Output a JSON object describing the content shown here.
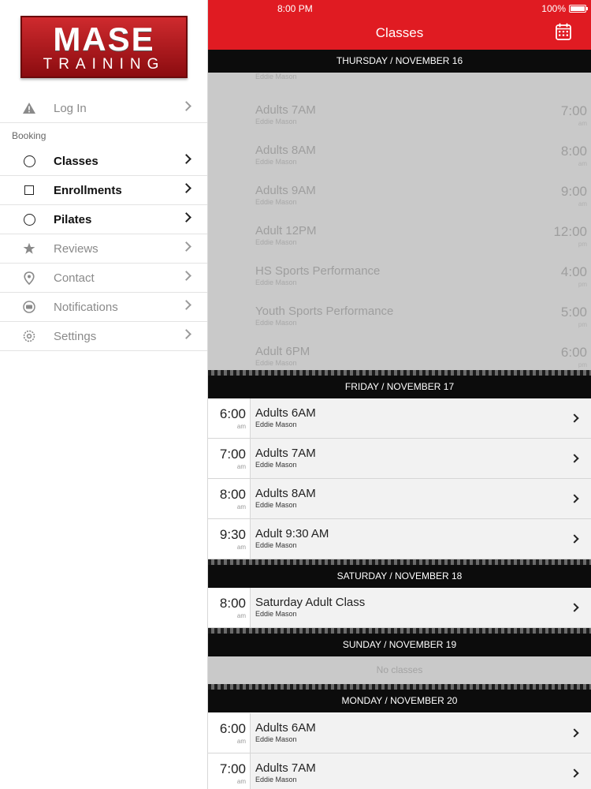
{
  "status_bar": {
    "time": "8:00 PM",
    "battery": "100%"
  },
  "logo": {
    "top": "MASE",
    "bottom": "TRAINING"
  },
  "header": {
    "title": "Classes",
    "calendar_icon": "calendar-icon"
  },
  "sidebar": {
    "section_label": "Booking",
    "login": {
      "label": "Log In",
      "icon": "warning-icon"
    },
    "items": [
      {
        "label": "Classes",
        "icon": "circle-icon"
      },
      {
        "label": "Enrollments",
        "icon": "square-icon"
      },
      {
        "label": "Pilates",
        "icon": "circle-icon"
      },
      {
        "label": "Reviews",
        "icon": "star-icon"
      },
      {
        "label": "Contact",
        "icon": "location-pin-icon"
      },
      {
        "label": "Notifications",
        "icon": "chat-bubble-icon"
      },
      {
        "label": "Settings",
        "icon": "gear-icon"
      }
    ]
  },
  "days": [
    {
      "header": "THURSDAY / NOVEMBER 16",
      "partial_instructor": "Eddie Mason",
      "classes": [
        {
          "time": "7:00",
          "ampm": "am",
          "name": "Adults 7AM",
          "instructor": "Eddie Mason"
        },
        {
          "time": "8:00",
          "ampm": "am",
          "name": "Adults 8AM",
          "instructor": "Eddie Mason"
        },
        {
          "time": "9:00",
          "ampm": "am",
          "name": "Adults 9AM",
          "instructor": "Eddie Mason"
        },
        {
          "time": "12:00",
          "ampm": "pm",
          "name": "Adult 12PM",
          "instructor": "Eddie Mason"
        },
        {
          "time": "4:00",
          "ampm": "pm",
          "name": "HS Sports Performance",
          "instructor": "Eddie Mason"
        },
        {
          "time": "5:00",
          "ampm": "pm",
          "name": "Youth Sports Performance",
          "instructor": "Eddie Mason"
        },
        {
          "time": "6:00",
          "ampm": "pm",
          "name": "Adult 6PM",
          "instructor": "Eddie Mason"
        }
      ]
    },
    {
      "header": "FRIDAY / NOVEMBER 17",
      "classes": [
        {
          "time": "6:00",
          "ampm": "am",
          "name": "Adults 6AM",
          "instructor": "Eddie Mason"
        },
        {
          "time": "7:00",
          "ampm": "am",
          "name": "Adults 7AM",
          "instructor": "Eddie Mason"
        },
        {
          "time": "8:00",
          "ampm": "am",
          "name": "Adults 8AM",
          "instructor": "Eddie Mason"
        },
        {
          "time": "9:30",
          "ampm": "am",
          "name": "Adult 9:30 AM",
          "instructor": "Eddie Mason"
        }
      ]
    },
    {
      "header": "SATURDAY / NOVEMBER 18",
      "classes": [
        {
          "time": "8:00",
          "ampm": "am",
          "name": "Saturday Adult Class",
          "instructor": "Eddie Mason"
        }
      ]
    },
    {
      "header": "SUNDAY / NOVEMBER 19",
      "empty_text": "No classes"
    },
    {
      "header": "MONDAY / NOVEMBER 20",
      "classes": [
        {
          "time": "6:00",
          "ampm": "am",
          "name": "Adults 6AM",
          "instructor": "Eddie Mason"
        },
        {
          "time": "7:00",
          "ampm": "am",
          "name": "Adults 7AM",
          "instructor": "Eddie Mason"
        }
      ]
    }
  ]
}
